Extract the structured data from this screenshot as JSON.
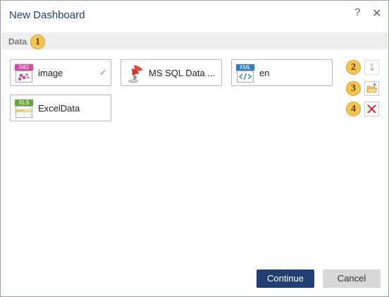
{
  "dialog": {
    "title": "New Dashboard",
    "help_label": "?",
    "close_label": "✕"
  },
  "section": {
    "label": "Data",
    "badge": "1"
  },
  "datasources": [
    {
      "label": "image",
      "icon": "image-file-icon",
      "tag": "IMG",
      "selected": true,
      "check": "✓"
    },
    {
      "label": "MS SQL Data ...",
      "icon": "ms-sql-icon"
    },
    {
      "label": "en",
      "icon": "xml-file-icon",
      "tag": "XML"
    },
    {
      "label": "ExcelData",
      "icon": "excel-file-icon",
      "tag": "XLS"
    }
  ],
  "side_actions": [
    {
      "badge": "2",
      "icon": "arrow-down-icon",
      "enabled": false
    },
    {
      "badge": "3",
      "icon": "open-folder-icon",
      "enabled": true
    },
    {
      "badge": "4",
      "icon": "delete-icon",
      "enabled": true
    }
  ],
  "footer": {
    "continue_label": "Continue",
    "cancel_label": "Cancel"
  },
  "colors": {
    "title": "#1f3f74",
    "primary_button": "#1f3f74",
    "badge": "#f5c451",
    "delete": "#e32d2d"
  }
}
